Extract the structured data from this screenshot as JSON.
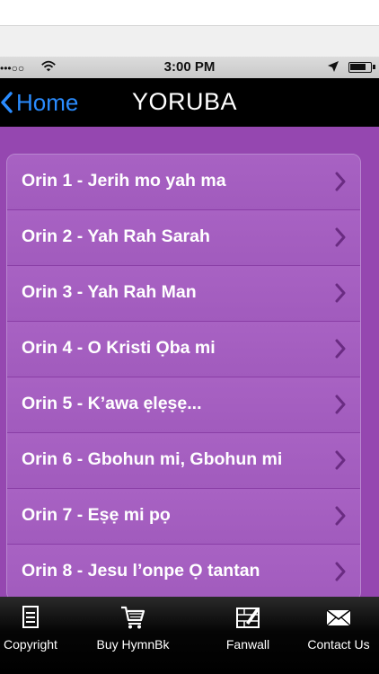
{
  "status_bar": {
    "time": "3:00 PM",
    "signal": "•••○○"
  },
  "nav": {
    "back_label": "Home",
    "title": "YORUBA"
  },
  "hymns": [
    "Orin 1 - Jerih mo yah ma",
    "Orin 2 - Yah Rah Sarah",
    "Orin 3 - Yah Rah Man",
    "Orin 4 - O Kristi Ọba mi",
    "Orin 5 - K’awa ẹlẹṣẹ...",
    "Orin 6 - Gbohun mi, Gbohun mi",
    "Orin 7 - Eṣẹ mi pọ",
    "Orin 8 - Jesu l’onpe Ọ tantan"
  ],
  "tabs": [
    {
      "label": "Copyright",
      "icon": "document-icon"
    },
    {
      "label": "Buy HymnBk",
      "icon": "cart-icon"
    },
    {
      "label": "Fanwall",
      "icon": "fanwall-icon"
    },
    {
      "label": "Contact Us",
      "icon": "envelope-icon"
    }
  ],
  "colors": {
    "background": "#9547b0",
    "row": "#a45fc0",
    "back_link": "#2a8cff"
  }
}
